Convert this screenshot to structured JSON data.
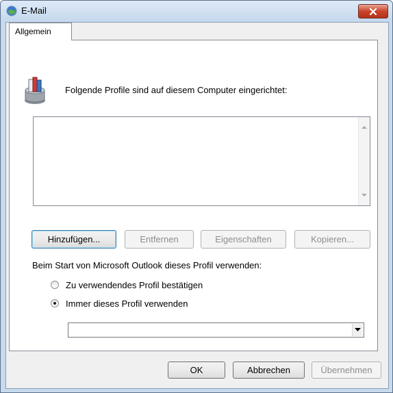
{
  "window": {
    "title": "E-Mail",
    "close_icon": "close-icon"
  },
  "tabs": [
    {
      "label": "Allgemein"
    }
  ],
  "panel": {
    "heading": "Folgende Profile sind auf diesem Computer eingerichtet:",
    "profile_list": [],
    "buttons": {
      "add": "Hinzufügen...",
      "remove": "Entfernen",
      "properties": "Eigenschaften",
      "copy": "Kopieren..."
    },
    "startup_label": "Beim Start von Microsoft Outlook dieses Profil verwenden:",
    "radio_prompt": "Zu verwendendes Profil bestätigen",
    "radio_always": "Immer dieses Profil verwenden",
    "selected_radio": "always",
    "profile_select_value": ""
  },
  "footer": {
    "ok": "OK",
    "cancel": "Abbrechen",
    "apply": "Übernehmen"
  },
  "colors": {
    "accent": "#3c7fb1",
    "close": "#c9442a",
    "titlebar": "#c5d8ee"
  }
}
